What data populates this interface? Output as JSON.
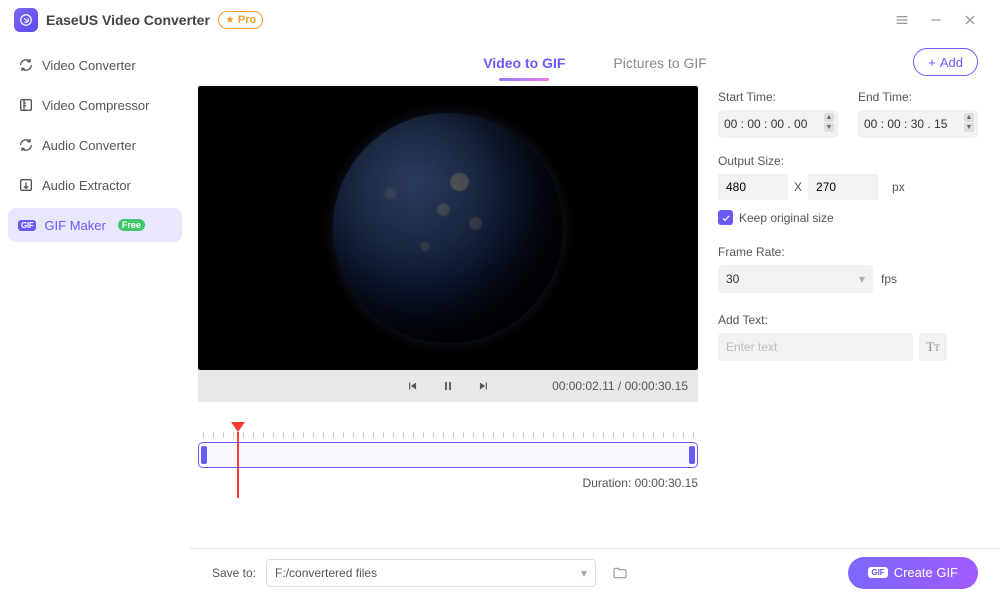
{
  "app": {
    "title": "EaseUS Video Converter",
    "pro_badge": "Pro"
  },
  "sidebar": {
    "items": [
      {
        "label": "Video Converter"
      },
      {
        "label": "Video Compressor"
      },
      {
        "label": "Audio Converter"
      },
      {
        "label": "Audio Extractor"
      },
      {
        "label": "GIF Maker",
        "badge": "Free"
      }
    ]
  },
  "tabs": {
    "video_to_gif": "Video to GIF",
    "pictures_to_gif": "Pictures to GIF",
    "add_button": "Add"
  },
  "player": {
    "current_time": "00:00:02.11",
    "total_time": "00:00:30.15"
  },
  "timeline": {
    "duration_label": "Duration:",
    "duration_value": "00:00:30.15"
  },
  "settings": {
    "start_time": {
      "label": "Start Time:",
      "value": "00 : 00 : 00 . 00"
    },
    "end_time": {
      "label": "End Time:",
      "value": "00 : 00 : 30 . 15"
    },
    "output_size": {
      "label": "Output Size:",
      "width": "480",
      "separator": "X",
      "height": "270",
      "unit": "px"
    },
    "keep_original": "Keep original size",
    "frame_rate": {
      "label": "Frame Rate:",
      "value": "30",
      "unit": "fps"
    },
    "add_text": {
      "label": "Add Text:",
      "placeholder": "Enter text"
    }
  },
  "footer": {
    "save_to_label": "Save to:",
    "save_path": "F:/convertered files",
    "create_button": "Create GIF"
  }
}
